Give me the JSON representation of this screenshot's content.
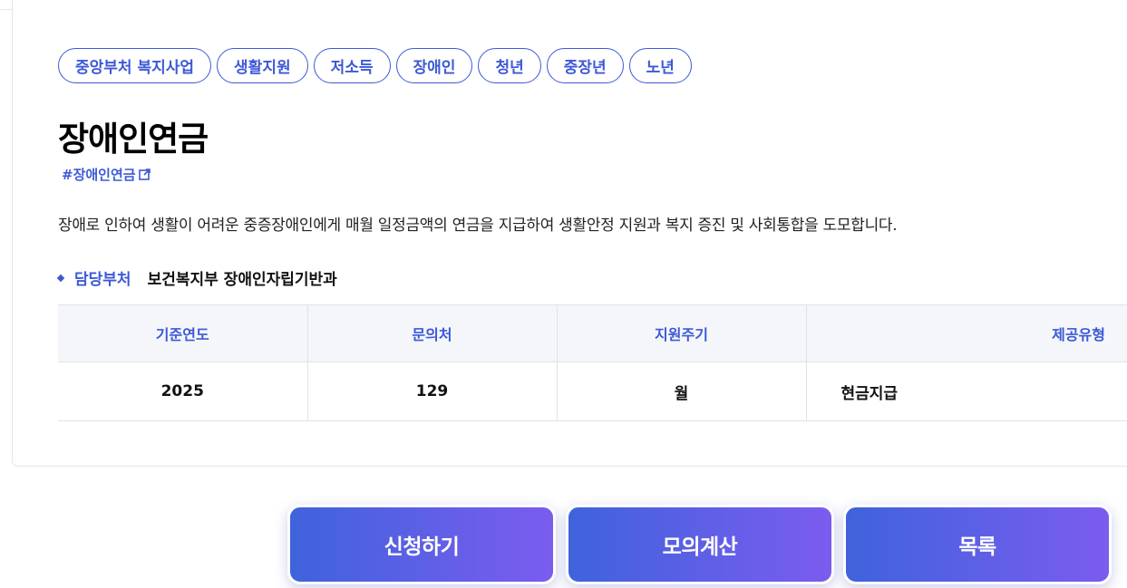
{
  "tags": [
    "중앙부처 복지사업",
    "생활지원",
    "저소득",
    "장애인",
    "청년",
    "중장년",
    "노년"
  ],
  "title": "장애인연금",
  "hashtag": "#장애인연금",
  "description": "장애로 인하여 생활이 어려운 중증장애인에게 매월 일정금액의 연금을 지급하여 생활안정 지원과 복지 증진 및 사회통합을 도모합니다.",
  "department": {
    "label": "담당부처",
    "value": "보건복지부 장애인자립기반과"
  },
  "table": {
    "headers": [
      "기준연도",
      "문의처",
      "지원주기",
      "제공유형"
    ],
    "row": [
      "2025",
      "129",
      "월",
      "현금지급"
    ]
  },
  "buttons": {
    "apply": "신청하기",
    "simulate": "모의계산",
    "list": "목록"
  },
  "colors": {
    "accent": "#3d59d6",
    "gradient_start": "#3f63dc",
    "gradient_end": "#7b5cef"
  },
  "icons": {
    "hashtag_link": "external-link-icon",
    "department_bullet": "diamond-bullet-icon"
  }
}
